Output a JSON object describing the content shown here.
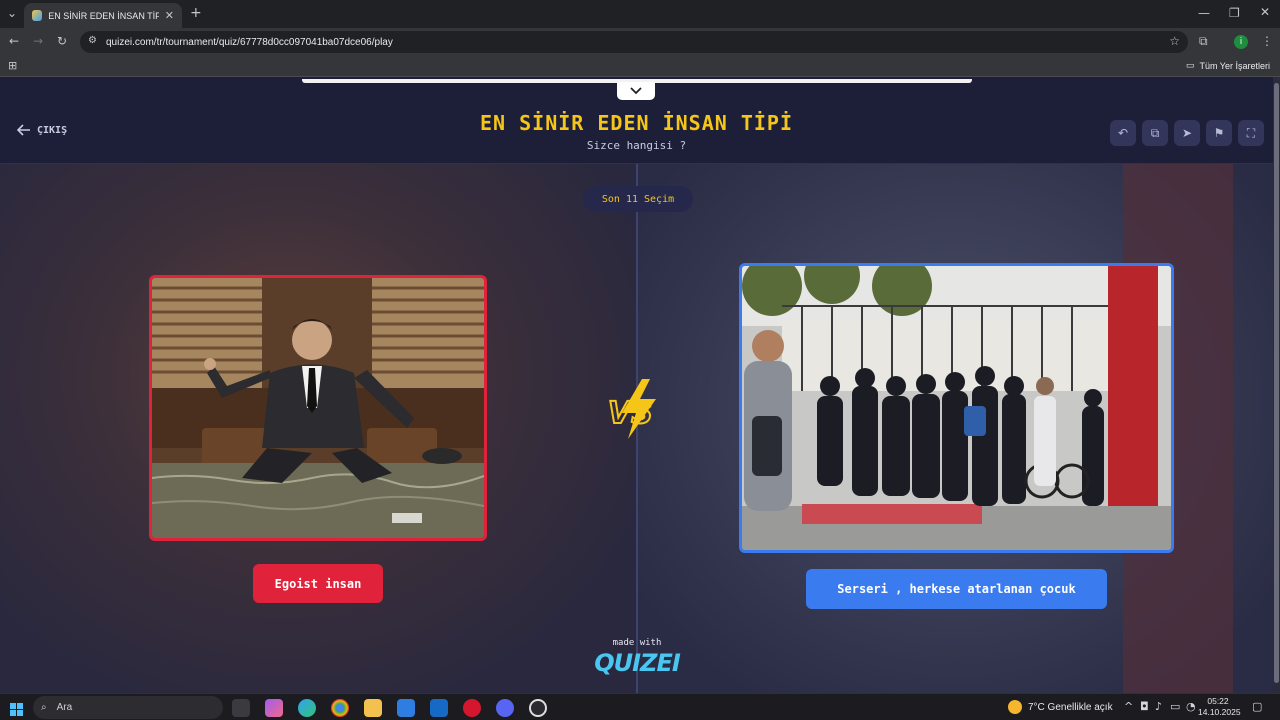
{
  "browser": {
    "tab_title": "EN SİNİR EDEN İNSAN TİPİ - Qu",
    "url": "quizei.com/tr/tournament/quiz/67778d0cc097041ba07dce06/play",
    "bookmarks_label": "Tüm Yer İşaretleri",
    "profile_initial": "i"
  },
  "header": {
    "exit_label": "ÇIKIŞ",
    "title": "EN SİNİR EDEN İNSAN TİPİ",
    "subtitle": "Sizce hangisi ?"
  },
  "round": {
    "label": "Son 11 Seçim"
  },
  "options": {
    "left": {
      "label": "Egoist insan",
      "accent": "#e0223a"
    },
    "right": {
      "label": "Serseri , herkese atarlanan çocuk",
      "accent": "#3a7cf0"
    }
  },
  "vs_text": "VS",
  "footer": {
    "made_with": "made with",
    "brand": "QUIZEI"
  },
  "taskbar": {
    "search_placeholder": "Ara",
    "weather": "7°C  Genellikle açık",
    "time": "05:22",
    "date": "14.10.2025"
  },
  "colors": {
    "title": "#f5c518",
    "page_bg": "#1d1f38"
  }
}
